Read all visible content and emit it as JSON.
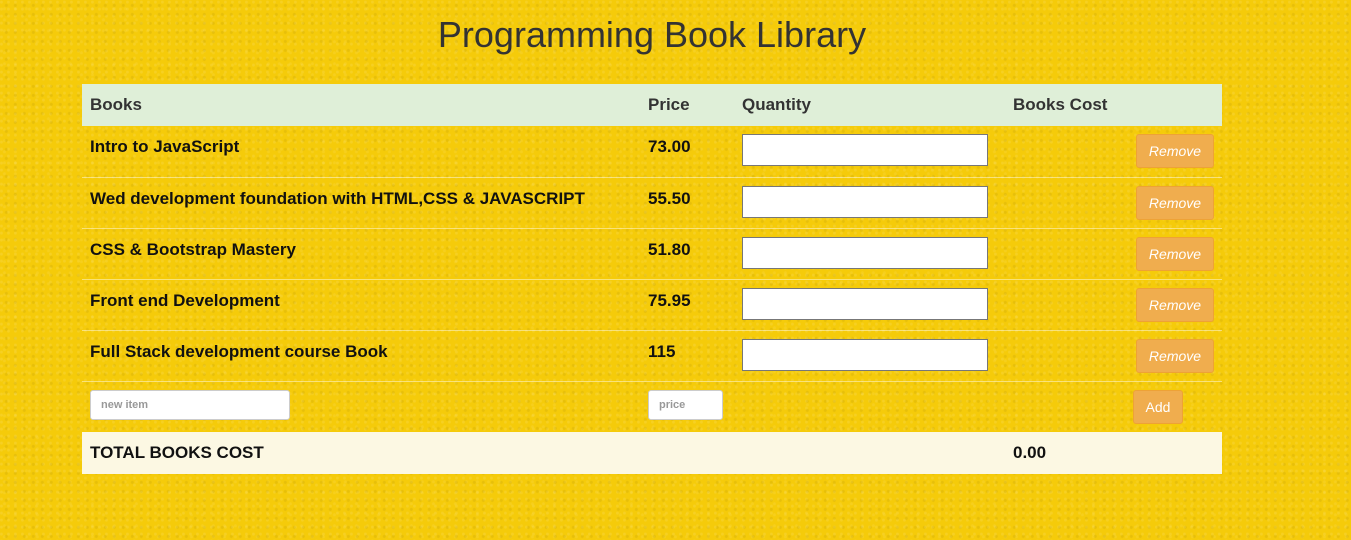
{
  "page": {
    "title": "Programming Book Library"
  },
  "table": {
    "headers": {
      "books": "Books",
      "price": "Price",
      "quantity": "Quantity",
      "books_cost": "Books Cost"
    },
    "rows": [
      {
        "name": "Intro to JavaScript",
        "price": "73.00",
        "quantity": "",
        "cost": ""
      },
      {
        "name": "Wed development foundation with HTML,CSS & JAVASCRIPT",
        "price": "55.50",
        "quantity": "",
        "cost": ""
      },
      {
        "name": "CSS & Bootstrap Mastery",
        "price": "51.80",
        "quantity": "",
        "cost": ""
      },
      {
        "name": "Front end Development",
        "price": "75.95",
        "quantity": "",
        "cost": ""
      },
      {
        "name": "Full Stack development course Book",
        "price": "115",
        "quantity": "",
        "cost": ""
      }
    ],
    "remove_label": "Remove",
    "add_row": {
      "name_placeholder": "new item",
      "price_placeholder": "price",
      "add_label": "Add"
    },
    "total": {
      "label": "TOTAL BOOKS COST",
      "value": "0.00"
    }
  },
  "colors": {
    "background": "#f5cb0a",
    "header_row": "#dfefd8",
    "total_row": "#fcf8e3",
    "button": "#f0ad4e"
  }
}
